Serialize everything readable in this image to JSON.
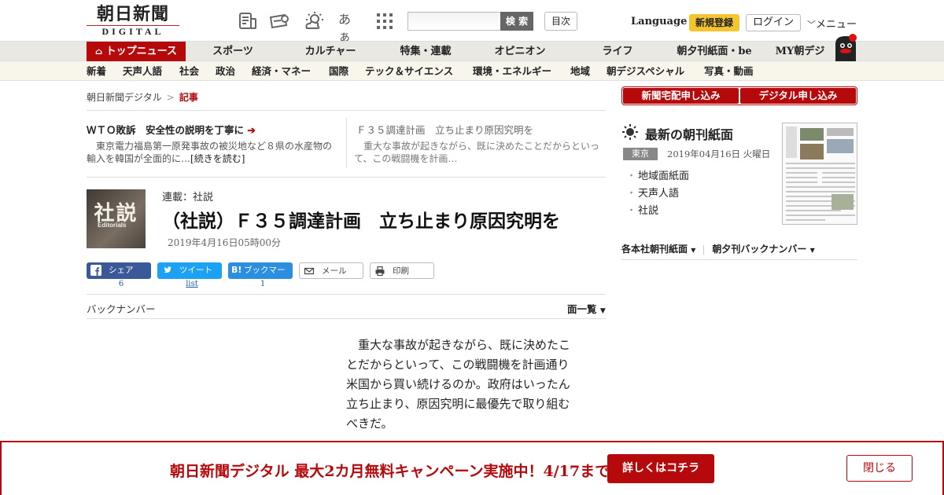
{
  "header": {
    "logo_top": "朝日新聞",
    "logo_bottom": "DIGITAL",
    "icons": [
      "paper-icon",
      "voucher-icon",
      "weather-icon",
      "font-size-icon",
      "apps-grid-icon"
    ],
    "font_size_label": "あぁ",
    "search_placeholder": "",
    "search_button": "検 索",
    "toc_button": "目次",
    "language": "Language",
    "register": "新規登録",
    "login": "ログイン",
    "menu": "メニュー"
  },
  "main_nav": [
    "トップニュース",
    "スポーツ",
    "カルチャー",
    "特集・連載",
    "オピニオン",
    "ライフ",
    "朝夕刊紙面・be",
    "MY朝デジ"
  ],
  "sub_nav": [
    "新着",
    "天声人語",
    "社会",
    "政治",
    "経済・マネー",
    "国際",
    "テック＆サイエンス",
    "環境・エネルギー",
    "地域",
    "朝デジスペシャル",
    "写真・動画"
  ],
  "breadcrumb": {
    "home": "朝日新聞デジタル",
    "sep": ">",
    "current": "記事"
  },
  "related": [
    {
      "title": "ＷＴＯ敗訴　安全性の説明を丁寧に",
      "text1": "　東京電力福島第一原発事故の被災地など８県の水産物の",
      "text2": "輸入を韓国が全面的に…",
      "more": "[続きを読む]"
    },
    {
      "title": "Ｆ３５調達計画　立ち止まり原因究明を",
      "text1": "　重大な事故が起きながら、既に決めたことだからといっ",
      "text2": "て、この戦闘機を計画…"
    }
  ],
  "article": {
    "thumb_big": "社説",
    "thumb_small": "Editorials",
    "series": "連載：社説",
    "title": "（社説）Ｆ３５調達計画　立ち止まり原因究明を",
    "date": "2019年4月16日05時00分",
    "body_lines": [
      "　重大な事故が起きながら、既に決めたこ",
      "とだからといって、この戦闘機を計画通り",
      "米国から買い続けるのか。政府はいったん",
      "立ち止まり、原因究明に最優先で取り組む",
      "べきだ。"
    ]
  },
  "share": {
    "facebook": {
      "label": "シェア",
      "count": "6"
    },
    "twitter": {
      "label": "ツイート",
      "count": "list"
    },
    "hatena": {
      "label": "ブックマーク",
      "count": "1"
    },
    "mail": {
      "label": "メール"
    },
    "print": {
      "label": "印刷"
    }
  },
  "backnumber": "バックナンバー",
  "page_list": "面一覧",
  "sidebar": {
    "subscribe_paper": "新聞宅配申し込み",
    "subscribe_digital": "デジタル申し込み",
    "latest_title": "最新の朝刊紙面",
    "region": "東京",
    "latest_date": "2019年04月16日 火曜日",
    "latest_items": [
      "地域面紙面",
      "天声人語",
      "社説"
    ],
    "link_branch": "各本社朝刊紙面",
    "link_archive": "朝夕刊バックナンバー"
  },
  "banner": {
    "text": "朝日新聞デジタル 最大2カ月無料キャンペーン実施中！4/17まで",
    "cta": "詳しくはコチラ",
    "close": "閉じる"
  },
  "colors": {
    "brand_red": "#b6090c",
    "register_yellow": "#f5c431",
    "facebook": "#3b5998",
    "twitter": "#1da1f2",
    "hatena": "#2c8ee0"
  }
}
